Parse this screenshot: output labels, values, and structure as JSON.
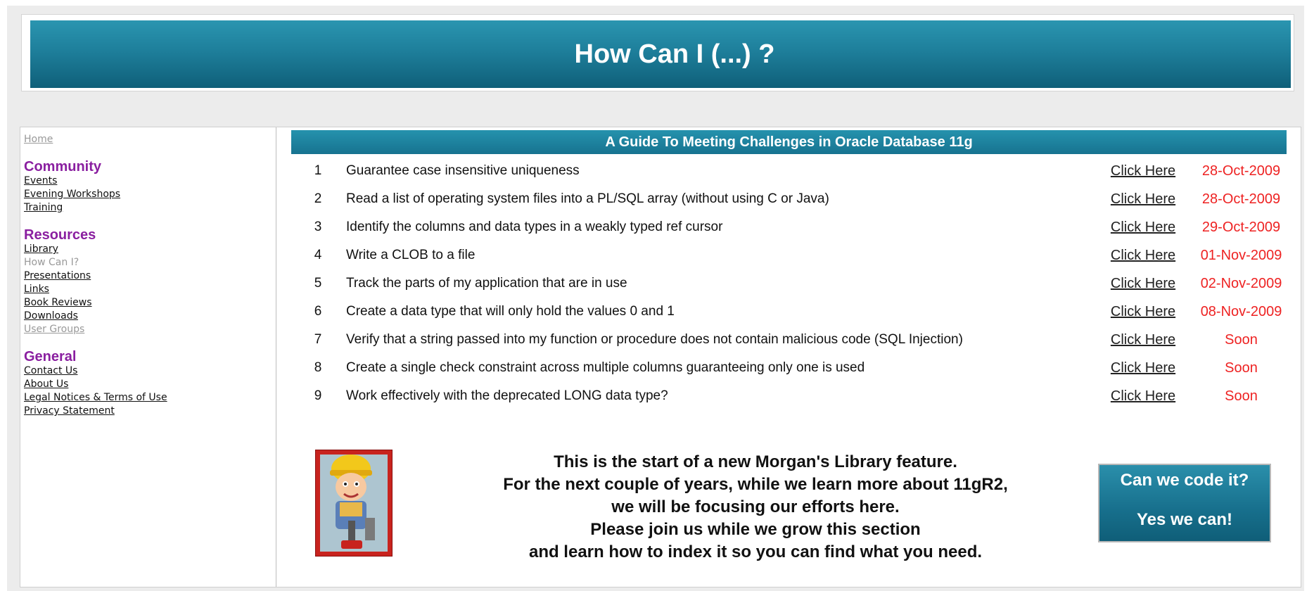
{
  "banner": {
    "title": "How Can I (...) ?"
  },
  "sidebar": {
    "home": "Home",
    "sections": [
      {
        "heading": "Community",
        "links": [
          "Events",
          "Evening Workshops",
          "Training"
        ]
      },
      {
        "heading": "Resources",
        "links": [
          "Library",
          "How Can I?",
          "Presentations",
          "Links",
          "Book Reviews",
          "Downloads",
          "User Groups"
        ]
      },
      {
        "heading": "General",
        "links": [
          "Contact Us",
          "About Us",
          "Legal Notices & Terms of Use",
          "Privacy Statement"
        ]
      }
    ]
  },
  "main": {
    "heading": "A Guide To Meeting Challenges in Oracle Database 11g",
    "rows": [
      {
        "num": "1",
        "desc": "Guarantee case insensitive uniqueness",
        "link": "Click Here",
        "date": "28-Oct-2009"
      },
      {
        "num": "2",
        "desc": "Read a list of operating system files into a PL/SQL array (without using C or Java)",
        "link": "Click Here",
        "date": "28-Oct-2009"
      },
      {
        "num": "3",
        "desc": "Identify the columns and data types in a weakly typed ref cursor",
        "link": "Click Here",
        "date": "29-Oct-2009"
      },
      {
        "num": "4",
        "desc": "Write a CLOB to a file",
        "link": "Click Here",
        "date": "01-Nov-2009"
      },
      {
        "num": "5",
        "desc": "Track the parts of my application that are in use",
        "link": "Click Here",
        "date": "02-Nov-2009"
      },
      {
        "num": "6",
        "desc": "Create a data type that will only hold the values 0 and 1",
        "link": "Click Here",
        "date": "08-Nov-2009"
      },
      {
        "num": "7",
        "desc": "Verify that a string passed into my function or procedure does not contain malicious code (SQL Injection)",
        "link": "Click Here",
        "date": "Soon"
      },
      {
        "num": "8",
        "desc": "Create a single check constraint across multiple columns guaranteeing only one is used",
        "link": "Click Here",
        "date": "Soon"
      },
      {
        "num": "9",
        "desc": "Work effectively with the deprecated LONG data type?",
        "link": "Click Here",
        "date": "Soon"
      }
    ],
    "message": [
      "This is the start of a new Morgan's Library feature.",
      "For the next couple of years, while we learn more about 11gR2,",
      "we will be focusing our efforts here.",
      "Please join us while we grow this section",
      "and learn how to index it so you can find what you need."
    ],
    "cta": {
      "line1": "Can we code it?",
      "line2": "Yes we can!"
    }
  },
  "colors": {
    "banner": "#1e7f9b",
    "heading": "#8a1fa0",
    "date": "#ee2222"
  },
  "icons": {
    "mascot": "builder-mascot-image"
  }
}
